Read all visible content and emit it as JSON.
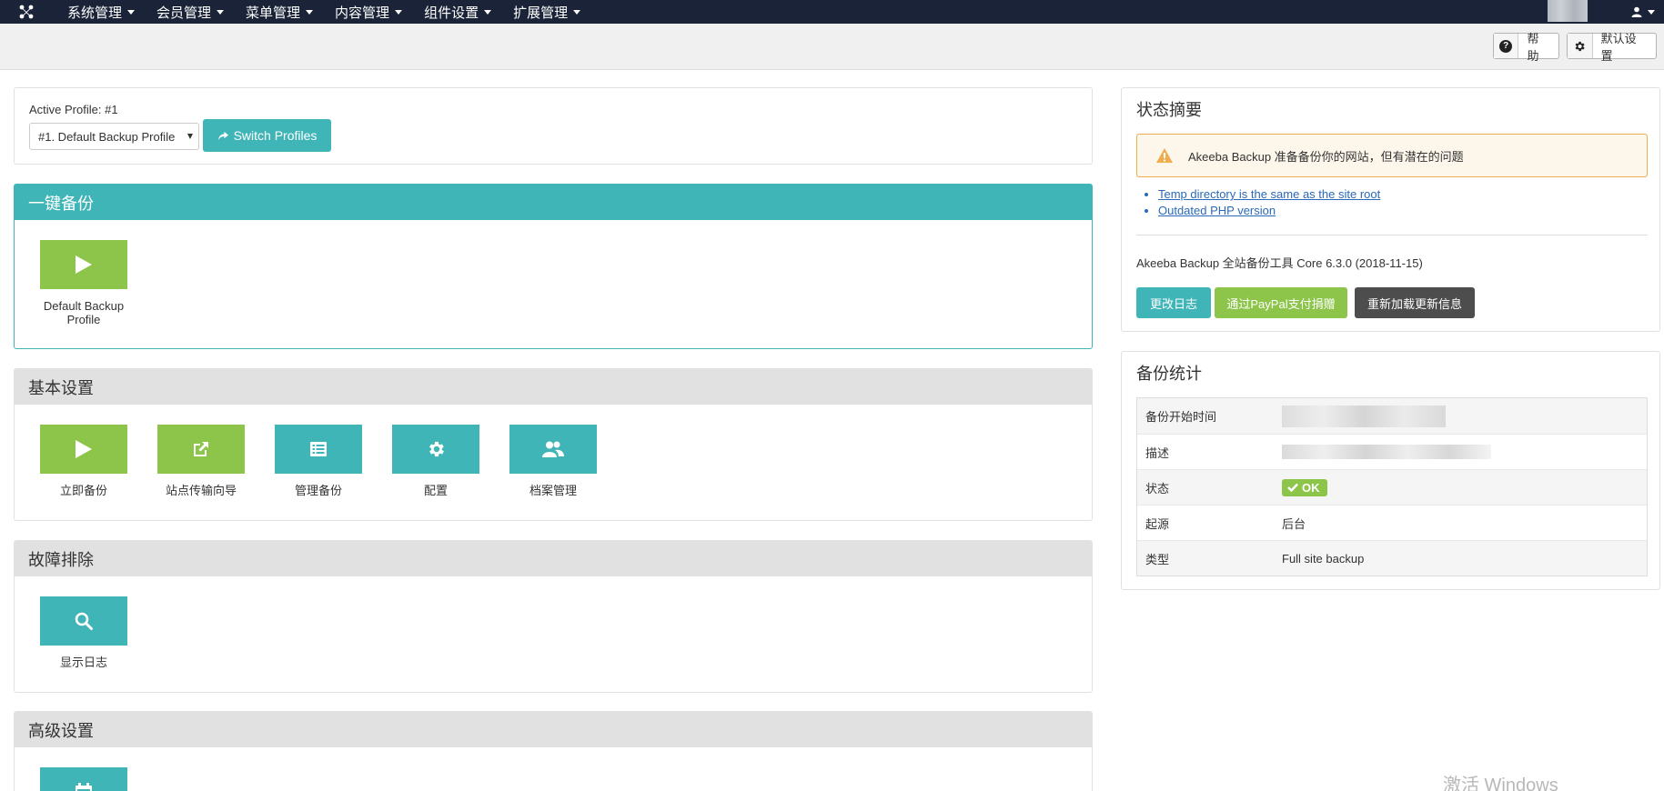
{
  "nav": {
    "logo_icon": "joomla-logo-icon",
    "items": [
      {
        "label": "系统管理"
      },
      {
        "label": "会员管理"
      },
      {
        "label": "菜单管理"
      },
      {
        "label": "内容管理"
      },
      {
        "label": "组件设置"
      },
      {
        "label": "扩展管理"
      }
    ],
    "user_icon": "user-icon"
  },
  "toolbar": {
    "help_label": "帮助",
    "options_label": "默认设置"
  },
  "profile": {
    "active_label": "Active Profile: #1",
    "select_value": "#1. Default Backup Profile",
    "switch_label": "Switch Profiles"
  },
  "one_click": {
    "title": "一键备份",
    "items": [
      {
        "label": "Default Backup Profile",
        "icon": "play-icon"
      }
    ]
  },
  "basic": {
    "title": "基本设置",
    "items": [
      {
        "label": "立即备份",
        "icon": "play-icon"
      },
      {
        "label": "站点传输向导",
        "icon": "external-link-icon"
      },
      {
        "label": "管理备份",
        "icon": "list-icon"
      },
      {
        "label": "配置",
        "icon": "gear-icon"
      },
      {
        "label": "档案管理",
        "icon": "users-icon"
      }
    ]
  },
  "troubleshoot": {
    "title": "故障排除",
    "items": [
      {
        "label": "显示日志",
        "icon": "search-icon"
      }
    ]
  },
  "advanced": {
    "title": "高级设置",
    "items": [
      {
        "label": "",
        "icon": "calendar-icon"
      }
    ]
  },
  "status": {
    "title": "状态摘要",
    "alert": "Akeeba Backup 准备备份你的网站，但有潜在的问题",
    "links": [
      "Temp directory is the same as the site root",
      "Outdated PHP version"
    ],
    "version": "Akeeba Backup 全站备份工具 Core 6.3.0 (2018-11-15)",
    "buttons": {
      "changelog": "更改日志",
      "donate": "通过PayPal支付捐赠",
      "reload": "重新加载更新信息"
    }
  },
  "stats": {
    "title": "备份统计",
    "rows": [
      {
        "key": "备份开始时间"
      },
      {
        "key": "描述"
      },
      {
        "key": "状态",
        "value": "OK"
      },
      {
        "key": "起源",
        "value": "后台"
      },
      {
        "key": "类型",
        "value": "Full site backup"
      }
    ]
  },
  "watermark": "激活 Windows",
  "colors": {
    "nav_bg": "#1a2337",
    "teal": "#40b5b8",
    "green": "#8dc54a",
    "dark_button": "#4d4d4d",
    "warning": "#f0ad4e",
    "link": "#2a6ab8"
  }
}
